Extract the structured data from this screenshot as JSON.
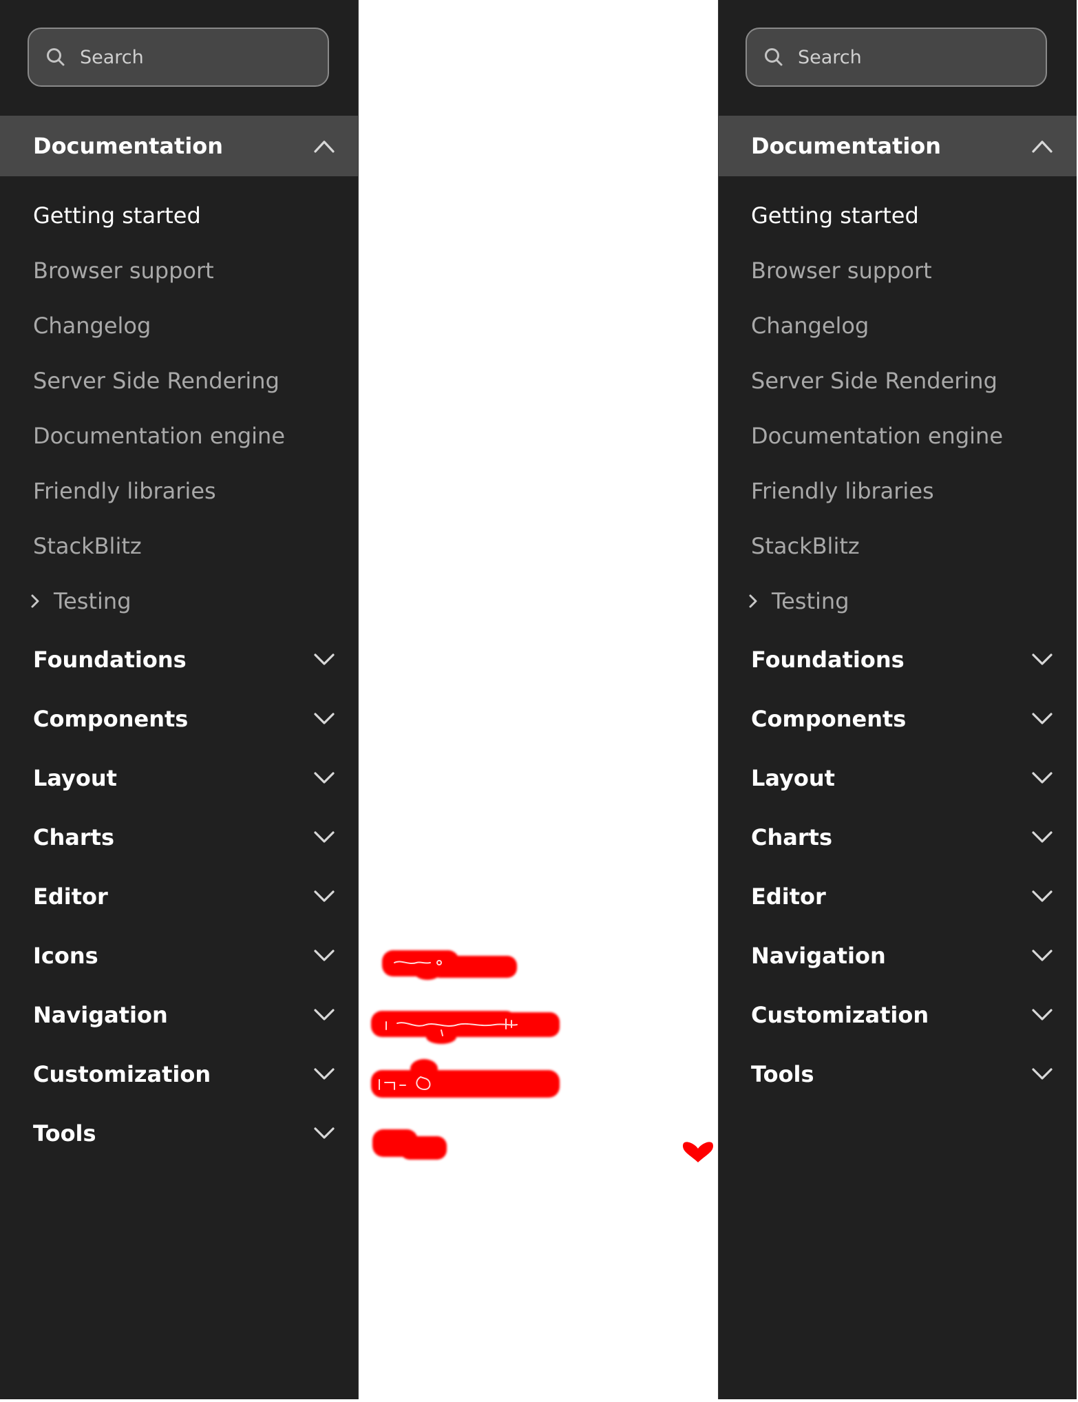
{
  "search": {
    "label": "Search"
  },
  "documentation": {
    "label": "Documentation",
    "items": [
      "Getting started",
      "Browser support",
      "Changelog",
      "Server Side Rendering",
      "Documentation engine",
      "Friendly libraries",
      "StackBlitz"
    ],
    "active_item": "Getting started",
    "testing_label": "Testing"
  },
  "left_sections": [
    "Foundations",
    "Components",
    "Layout",
    "Charts",
    "Editor",
    "Icons",
    "Navigation",
    "Customization",
    "Tools"
  ],
  "right_sections": [
    "Foundations",
    "Components",
    "Layout",
    "Charts",
    "Editor",
    "Navigation",
    "Customization",
    "Tools"
  ],
  "colors": {
    "panel_bg": "#202020",
    "header_bg": "#484848",
    "search_bg": "#464646",
    "text_active": "#ffffff",
    "text_muted": "#a9a9a9",
    "annotation_red": "#ff0000"
  },
  "icons": {
    "search": "search-icon",
    "expanded": "chevron-up-icon",
    "collapsed": "chevron-down-icon",
    "testing": "chevron-right-icon",
    "mark": "heart-icon"
  }
}
